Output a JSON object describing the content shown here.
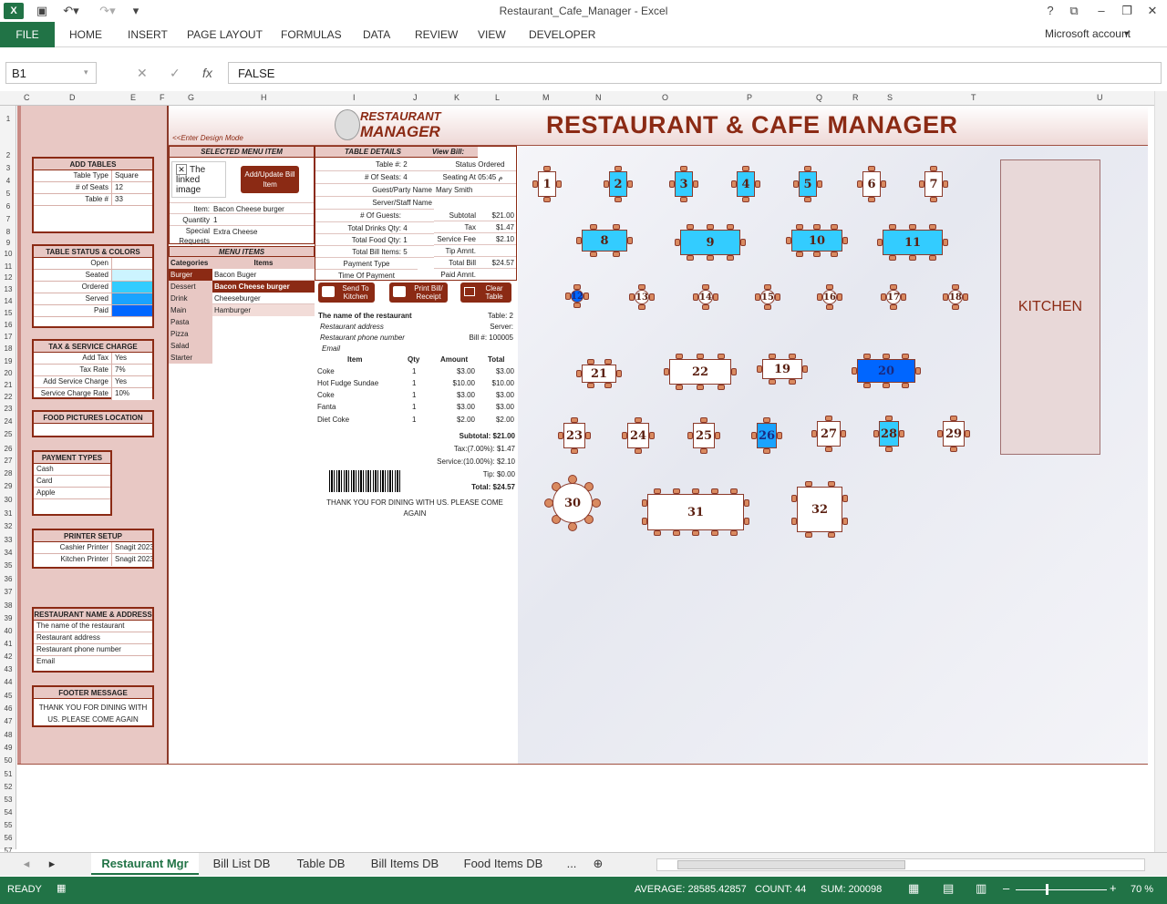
{
  "app": {
    "title": "Restaurant_Cafe_Manager - Excel",
    "account": "Microsoft account"
  },
  "ribbon": {
    "file": "FILE",
    "tabs": [
      "HOME",
      "INSERT",
      "PAGE LAYOUT",
      "FORMULAS",
      "DATA",
      "REVIEW",
      "VIEW",
      "DEVELOPER"
    ]
  },
  "formula": {
    "namebox": "B1",
    "value": "FALSE"
  },
  "columns": [
    "C",
    "D",
    "E",
    "F",
    "G",
    "H",
    "I",
    "J",
    "K",
    "L",
    "M",
    "N",
    "O",
    "P",
    "Q",
    "R",
    "S",
    "T",
    "U"
  ],
  "sheet": {
    "title": "RESTAURANT & CAFE MANAGER",
    "design_mode": "<<Enter Design Mode",
    "logo_line1": "RESTAURANT",
    "logo_line2": "MANAGER",
    "kitchen": "KITCHEN"
  },
  "left": {
    "add_tables": {
      "header": "ADD TABLES",
      "rows": [
        [
          "Table Type",
          "Square"
        ],
        [
          "# of Seats",
          "12"
        ],
        [
          "Table #",
          "33"
        ]
      ]
    },
    "status": {
      "header": "TABLE STATUS & COLORS",
      "rows": [
        "Open",
        "Seated",
        "Ordered",
        "Served",
        "Paid"
      ],
      "colors": [
        "#ffffff",
        "#ccf4ff",
        "#33ccff",
        "#1aa3ff",
        "#0066ff"
      ]
    },
    "tax": {
      "header": "TAX & SERVICE CHARGE",
      "rows": [
        [
          "Add Tax",
          "Yes"
        ],
        [
          "Tax Rate",
          "7%"
        ],
        [
          "Add Service Charge",
          "Yes"
        ],
        [
          "Service Charge Rate",
          "10%"
        ]
      ]
    },
    "food_pics": {
      "header": "FOOD PICTURES LOCATION"
    },
    "payment": {
      "header": "PAYMENT TYPES",
      "rows": [
        "Cash",
        "Card",
        "Apple"
      ]
    },
    "printer": {
      "header": "PRINTER SETUP",
      "rows": [
        [
          "Cashier Printer",
          "Snagit 2023"
        ],
        [
          "Kitchen Printer",
          "Snagit 2023"
        ]
      ]
    },
    "rest_name": {
      "header": "RESTAURANT NAME & ADDRESS",
      "rows": [
        "The name of the restaurant",
        "Restaurant address",
        "Restaurant phone number",
        "Email"
      ]
    },
    "footer": {
      "header": "FOOTER MESSAGE",
      "text": "THANK YOU FOR DINING WITH US. PLEASE COME AGAIN"
    }
  },
  "selected": {
    "header": "SELECTED MENU ITEM",
    "image_text": "The linked image",
    "add_btn": "Add/Update Bill Item",
    "item_label": "Item:",
    "item": "Bacon Cheese burger",
    "qty_label": "Quantity",
    "qty": "1",
    "special_label1": "Special",
    "special_label2": "Requests",
    "special": "Extra Cheese"
  },
  "menu": {
    "header": "MENU ITEMS",
    "cat_label": "Categories",
    "items_label": "Items",
    "categories": [
      "Burger",
      "Dessert",
      "Drink",
      "Main",
      "Pasta",
      "Pizza",
      "Salad",
      "Starter"
    ],
    "items": [
      "Bacon Buger",
      "Bacon Cheese burger",
      "Cheeseburger",
      "Hamburger"
    ]
  },
  "details": {
    "header": "TABLE DETAILS",
    "view_bill": "View Bill:",
    "left_rows": [
      [
        "Table #:",
        "2"
      ],
      [
        "# Of Seats:",
        "4"
      ],
      [
        "Guest/Party Name",
        ""
      ],
      [
        "Server/Staff Name",
        ""
      ],
      [
        "# Of Guests:",
        ""
      ],
      [
        "Total Drinks Qty:",
        "4"
      ],
      [
        "Total Food Qty:",
        "1"
      ],
      [
        "Total Bill Items:",
        "5"
      ],
      [
        "Payment Type",
        ""
      ],
      [
        "Time Of Payment",
        ""
      ]
    ],
    "status_label": "Status",
    "status": "Ordered",
    "seating_label": "Seating At",
    "seating": "05:45 م",
    "guest_name": "Mary Smith",
    "right_rows": [
      [
        "Subtotal",
        "$21.00"
      ],
      [
        "Tax",
        "$1.47"
      ],
      [
        "Service Fee",
        "$2.10"
      ],
      [
        "Tip Amnt.",
        ""
      ],
      [
        "Total Bill",
        "$24.57"
      ],
      [
        "Paid Amnt.",
        ""
      ]
    ]
  },
  "actions": [
    "Send To Kitchen",
    "Print Bill/ Receipt",
    "Clear Table"
  ],
  "receipt": {
    "name": "The name of the restaurant",
    "table": "Table: 2",
    "address": "Restaurant address",
    "server": "Server:",
    "phone": "Restaurant phone number",
    "bill": "Bill #: 100005",
    "email": "Email",
    "cols": [
      "Item",
      "Qty",
      "Amount",
      "Total"
    ],
    "lines": [
      [
        "Coke",
        "1",
        "$3.00",
        "$3.00"
      ],
      [
        "Hot Fudge Sundae",
        "1",
        "$10.00",
        "$10.00"
      ],
      [
        "Coke",
        "1",
        "$3.00",
        "$3.00"
      ],
      [
        "Fanta",
        "1",
        "$3.00",
        "$3.00"
      ],
      [
        "Diet Coke",
        "1",
        "$2.00",
        "$2.00"
      ]
    ],
    "subtotal": "Subtotal: $21.00",
    "tax": "Tax:(7.00%): $1.47",
    "service": "Service:(10.00%): $2.10",
    "tip": "Tip: $0.00",
    "total": "Total: $24.57",
    "thanks": "THANK YOU FOR DINING WITH US. PLEASE COME AGAIN"
  },
  "tables": [
    {
      "n": "1",
      "status": "Open"
    },
    {
      "n": "2",
      "status": "Ordered"
    },
    {
      "n": "3",
      "status": "Ordered"
    },
    {
      "n": "4",
      "status": "Ordered"
    },
    {
      "n": "5",
      "status": "Ordered"
    },
    {
      "n": "6",
      "status": "Open"
    },
    {
      "n": "7",
      "status": "Open"
    },
    {
      "n": "8",
      "status": "Ordered"
    },
    {
      "n": "9",
      "status": "Ordered"
    },
    {
      "n": "10",
      "status": "Ordered"
    },
    {
      "n": "11",
      "status": "Ordered"
    },
    {
      "n": "12",
      "status": "Paid"
    },
    {
      "n": "13",
      "status": "Open"
    },
    {
      "n": "14",
      "status": "Open"
    },
    {
      "n": "15",
      "status": "Open"
    },
    {
      "n": "16",
      "status": "Open"
    },
    {
      "n": "17",
      "status": "Open"
    },
    {
      "n": "18",
      "status": "Open"
    },
    {
      "n": "21",
      "status": "Open"
    },
    {
      "n": "22",
      "status": "Open"
    },
    {
      "n": "19",
      "status": "Open"
    },
    {
      "n": "20",
      "status": "Paid"
    },
    {
      "n": "23",
      "status": "Open"
    },
    {
      "n": "24",
      "status": "Open"
    },
    {
      "n": "25",
      "status": "Open"
    },
    {
      "n": "26",
      "status": "Served"
    },
    {
      "n": "27",
      "status": "Open"
    },
    {
      "n": "28",
      "status": "Ordered"
    },
    {
      "n": "29",
      "status": "Open"
    },
    {
      "n": "30",
      "status": "Open"
    },
    {
      "n": "31",
      "status": "Open"
    },
    {
      "n": "32",
      "status": "Open"
    }
  ],
  "sheet_tabs": [
    "Restaurant Mgr",
    "Bill List DB",
    "Table DB",
    "Bill Items DB",
    "Food Items DB",
    "..."
  ],
  "status": {
    "ready": "READY",
    "average": "AVERAGE: 28585.42857",
    "count": "COUNT: 44",
    "sum": "SUM: 200098",
    "zoom": "70 %"
  }
}
